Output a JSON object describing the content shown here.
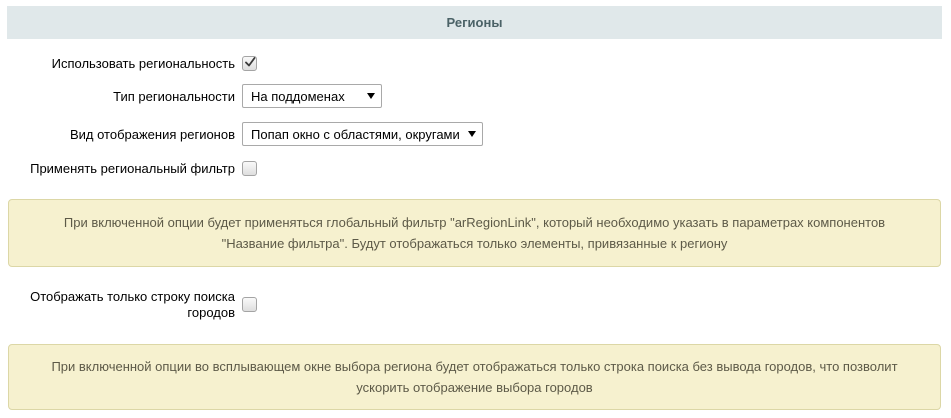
{
  "section": {
    "title": "Регионы"
  },
  "fields": {
    "use_regionality": {
      "label": "Использовать региональность",
      "checked": true
    },
    "regionality_type": {
      "label": "Тип региональности",
      "value": "На поддоменах"
    },
    "regions_display": {
      "label": "Вид отображения регионов",
      "value": "Попап окно с областями, округами"
    },
    "regional_filter": {
      "label": "Применять региональный фильтр",
      "checked": false
    },
    "search_only": {
      "label": "Отображать только строку поиска городов",
      "checked": false
    }
  },
  "notices": {
    "filter_hint": "При включенной опции будет применяться глобальный фильтр \"arRegionLink\", который необходимо указать в параметрах компонентов \"Название фильтра\". Будут отображаться только элементы, привязанные к региону",
    "search_hint": "При включенной опции во всплывающем окне выбора региона будет отображаться только строка поиска без вывода городов, что позволит ускорить отображение выбора городов"
  }
}
